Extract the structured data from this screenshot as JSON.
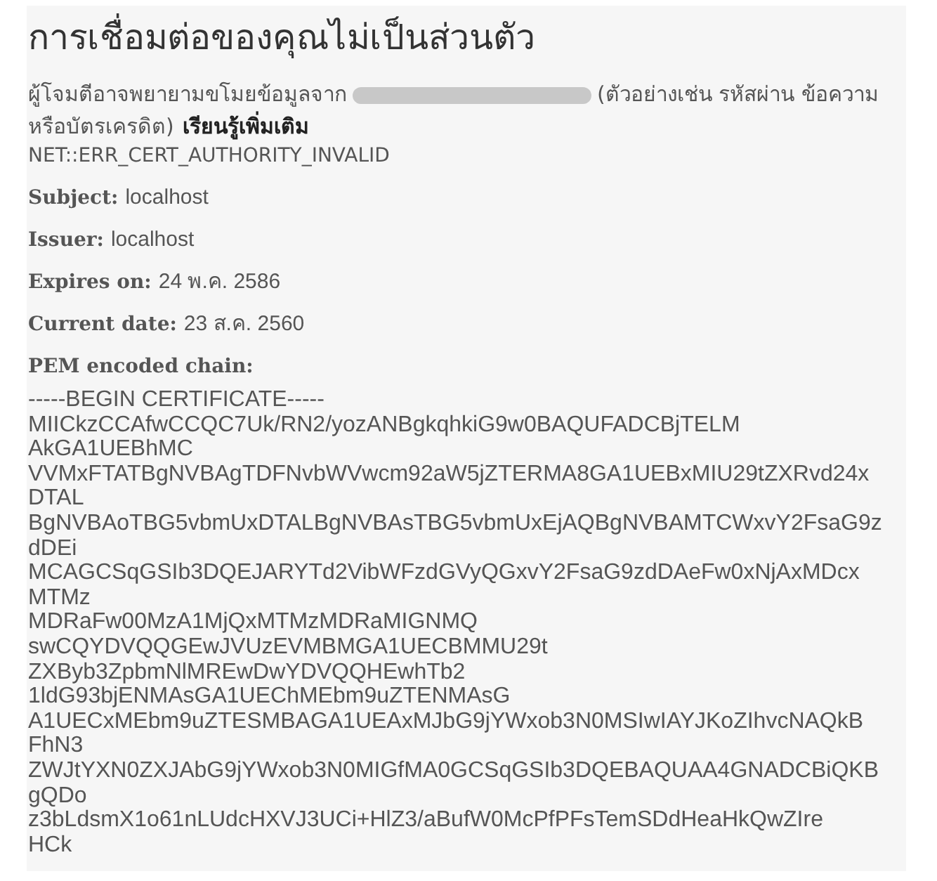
{
  "heading": "การเชื่อมต่อของคุณไม่เป็นส่วนตัว",
  "message": {
    "before": "ผู้โจมตีอาจพยายามขโมยข้อมูลจาก",
    "after": "(ตัวอย่างเช่น รหัสผ่าน ข้อความ หรือบัตรเครดิต)",
    "learn_more": "เรียนรู้เพิ่มเติม"
  },
  "error_code": "NET::ERR_CERT_AUTHORITY_INVALID",
  "details": [
    {
      "label": "Subject:",
      "value": "localhost"
    },
    {
      "label": "Issuer:",
      "value": "localhost"
    },
    {
      "label": "Expires on:",
      "value": "24 พ.ค. 2586"
    },
    {
      "label": "Current date:",
      "value": "23 ส.ค. 2560"
    },
    {
      "label": "PEM encoded chain:"
    }
  ],
  "pem_lines": [
    "-----BEGIN CERTIFICATE-----",
    "MIICkzCCAfwCCQC7Uk/RN2/yozANBgkqhkiG9w0BAQUFADCBjTELM",
    "AkGA1UEBhMC",
    "VVMxFTATBgNVBAgTDFNvbWVwcm92aW5jZTERMA8GA1UEBxMIU29tZXRvd24x",
    "DTAL",
    "BgNVBAoTBG5vbmUxDTALBgNVBAsTBG5vbmUxEjAQBgNVBAMTCWxvY2FsaG9z",
    "dDEi",
    "MCAGCSqGSIb3DQEJARYTd2VibWFzdGVyQGxvY2FsaG9zdDAeFw0xNjAxMDcx",
    "MTMz",
    "MDRaFw00MzA1MjQxMTMzMDRaMIGNMQ",
    "swCQYDVQQGEwJVUzEVMBMGA1UECBMMU29t",
    "ZXByb3ZpbmNlMREwDwYDVQQHEwhTb2",
    "1ldG93bjENMAsGA1UEChMEbm9uZTENMAsG",
    "A1UECxMEbm9uZTESMBAGA1UEAxMJbG9jYWxob3N0MSIwIAYJKoZIhvcNAQkB",
    "FhN3",
    "ZWJtYXN0ZXJAbG9jYWxob3N0MIGfMA0GCSqGSIb3DQEBAQUAA4GNADCBiQKB",
    "gQDo",
    "z3bLdsmX1o61nLUdcHXVJ3UCi+HlZ3/aBufW0McPfPFsTemSDdHeaHkQwZIre",
    "HCk"
  ]
}
